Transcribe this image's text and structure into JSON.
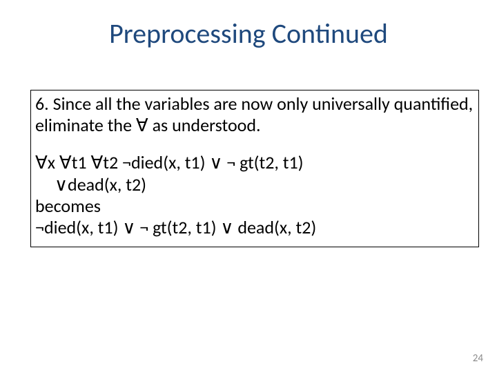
{
  "title": "Preprocessing Continued",
  "point6": {
    "number": "6.",
    "text_before_symbol": "Since all the variables are now only universally quantified, eliminate the ",
    "symbol": "∀",
    "text_after_symbol": " as understood."
  },
  "formula": {
    "line1": "∀x ∀t1 ∀t2 ¬died(x, t1) ∨  ¬ gt(t2, t1)",
    "line2": "∨dead(x, t2)",
    "becomes": "becomes",
    "line3": "¬died(x, t1) ∨  ¬ gt(t2, t1) ∨ dead(x, t2)"
  },
  "page_number": "24"
}
